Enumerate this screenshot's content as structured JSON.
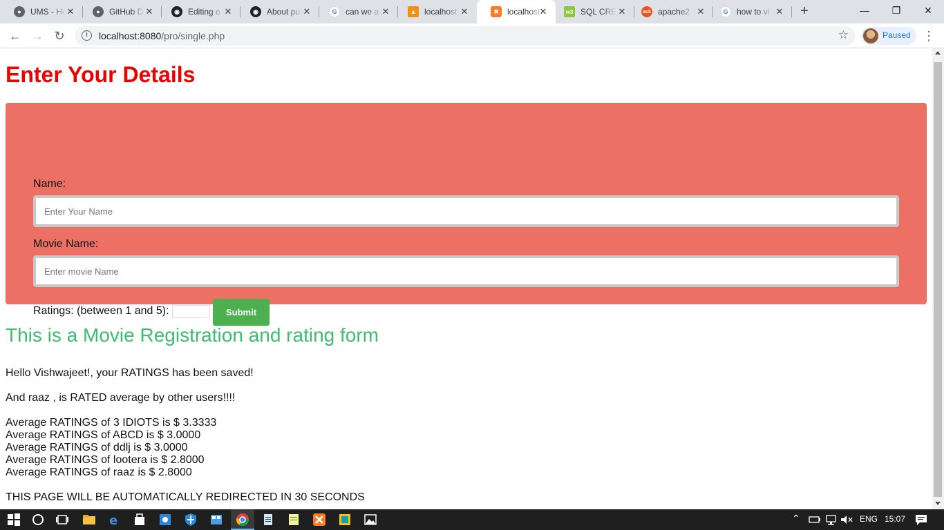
{
  "browser": {
    "tabs": [
      {
        "label": "UMS - Ho",
        "icon": "globe-icon",
        "color": "#5f6368"
      },
      {
        "label": "GitHub D",
        "icon": "globe-icon",
        "color": "#5f6368"
      },
      {
        "label": "Editing o",
        "icon": "github-icon",
        "color": "#202124"
      },
      {
        "label": "About pu",
        "icon": "github-icon",
        "color": "#202124"
      },
      {
        "label": "can we a",
        "icon": "google-icon",
        "color": "#4285f4"
      },
      {
        "label": "localhost",
        "icon": "phpmyadmin-icon",
        "color": "#f29111"
      },
      {
        "label": "localhost",
        "icon": "xampp-icon",
        "color": "#fb7a24"
      },
      {
        "label": "SQL CRE",
        "icon": "w3schools-icon",
        "color": "#8dc63f"
      },
      {
        "label": "apache2",
        "icon": "askubuntu-icon",
        "color": "#e95420"
      },
      {
        "label": "how to vi",
        "icon": "google-icon",
        "color": "#4285f4"
      }
    ],
    "active_tab_index": 6,
    "new_tab": "+",
    "url_host": "localhost:8080",
    "url_path": "/pro/single.php",
    "profile_label": "Paused"
  },
  "page": {
    "title": "Enter Your Details",
    "form": {
      "name_label": "Name:",
      "name_placeholder": "Enter Your Name",
      "movie_label": "Movie Name:",
      "movie_placeholder": "Enter movie Name",
      "rating_label": "Ratings: (between 1 and 5):",
      "submit_label": "Submit"
    },
    "subheading": "This is a Movie Registration and rating form",
    "messages": {
      "saved": "Hello Vishwajeet!, your RATINGS has been saved!",
      "rated": "And raaz , is RATED average by other users!!!!",
      "averages": [
        "Average RATINGS of 3 IDIOTS is $ 3.3333",
        "Average RATINGS of ABCD is $ 3.0000",
        "Average RATINGS of ddlj is $ 3.0000",
        "Average RATINGS of lootera is $ 2.8000",
        "Average RATINGS of raaz is $ 2.8000"
      ],
      "redirect": "THIS PAGE WILL BE AUTOMATICALLY REDIRECTED IN 30 SECONDS"
    },
    "colors": {
      "title": "#ee0000",
      "form_bg": "#ec7063",
      "submit_bg": "#4caf50",
      "subheading": "#3cbd6f"
    }
  },
  "taskbar": {
    "language": "ENG",
    "time": "15:07"
  }
}
